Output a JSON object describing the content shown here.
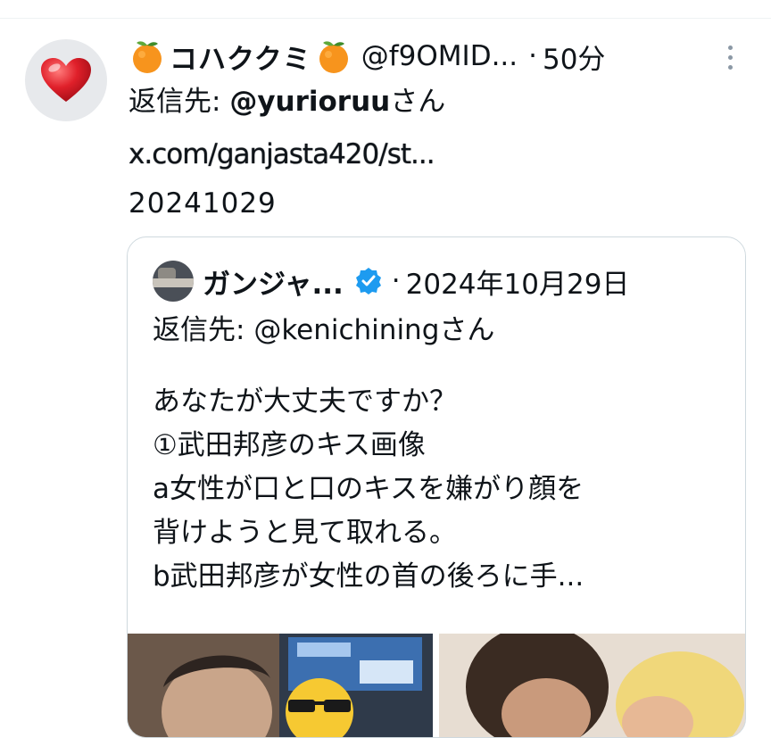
{
  "tweet": {
    "display_name": "コハククミ",
    "name_emoji": "tangerine",
    "handle": "@f9OMID...",
    "separator": "·",
    "time": "50分",
    "reply_prefix": "返信先: ",
    "reply_user": "@yurioruu",
    "reply_suffix": "さん",
    "link": "x.com/ganjasta420/st...",
    "text": "20241029"
  },
  "quote": {
    "display_name": "ガンジャ...",
    "verified": true,
    "separator": "·",
    "date": "2024年10月29日",
    "reply_prefix": "返信先: ",
    "reply_user": "@kenichining",
    "reply_suffix": "さん",
    "lines": [
      "あなたが大丈夫ですか？",
      "①武田邦彦のキス画像",
      "a女性が口と口のキスを嫌がり顔を",
      "背けようと見て取れる。",
      "b武田邦彦が女性の首の後ろに手..."
    ]
  },
  "icons": {
    "avatar": "red-heart-icon",
    "more": "more-options-icon",
    "verified": "verified-badge-icon",
    "media_overlay": "sunglasses-emoji-icon"
  },
  "colors": {
    "verified": "#1d9bf0",
    "heart": "#e0202a",
    "border": "#cfd9de"
  }
}
